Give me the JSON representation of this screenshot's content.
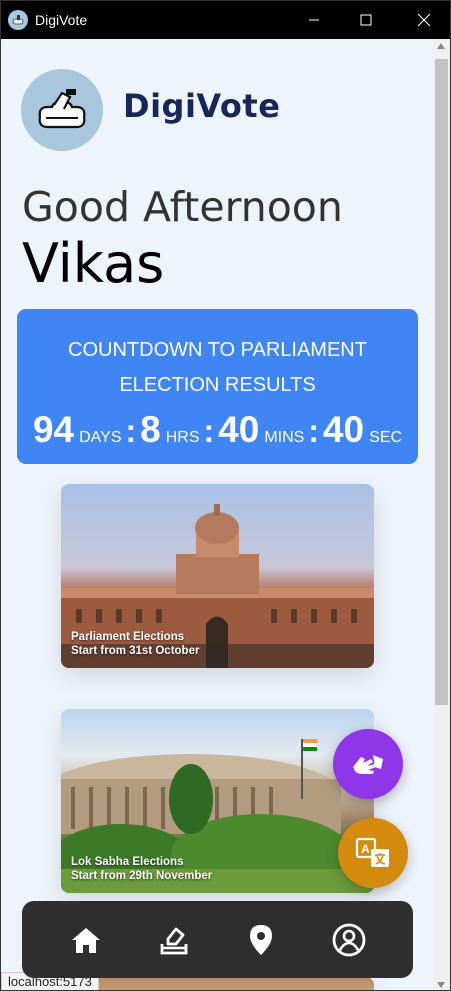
{
  "window": {
    "title": "DigiVote"
  },
  "app": {
    "brand": "DigiVote"
  },
  "greeting": {
    "salutation": "Good Afternoon",
    "name": "Vikas"
  },
  "countdown": {
    "heading": "COUNTDOWN TO PARLIAMENT ELECTION RESULTS",
    "days": "94",
    "days_label": "DAYS",
    "hours": "8",
    "hours_label": "HRS",
    "mins": "40",
    "mins_label": "MINS",
    "secs": "40",
    "secs_label": "SEC",
    "color": "#3f86f4"
  },
  "cards": [
    {
      "title": "Parliament Elections",
      "subtitle": "Start from 31st October"
    },
    {
      "title": "Lok Sabha Elections",
      "subtitle": "Start from 29th November"
    }
  ],
  "fabs": {
    "sign_language_icon": "sign-language-icon",
    "translate_icon": "translate-icon",
    "sign_color": "#8f36e8",
    "translate_color": "#d48a0c"
  },
  "nav": {
    "items": [
      "home-icon",
      "vote-icon",
      "location-icon",
      "profile-icon"
    ]
  },
  "status_bar": {
    "url": "localhost:5173"
  }
}
